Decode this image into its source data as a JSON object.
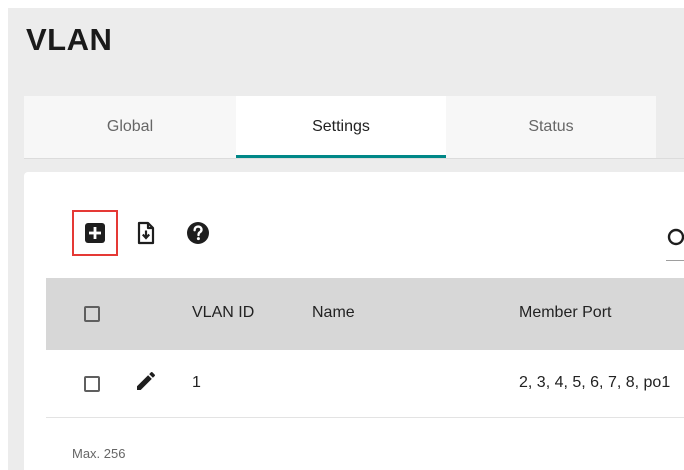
{
  "page": {
    "title": "VLAN"
  },
  "tabs": [
    {
      "label": "Global",
      "active": false
    },
    {
      "label": "Settings",
      "active": true
    },
    {
      "label": "Status",
      "active": false
    }
  ],
  "toolbar": {
    "add_icon": "add-box-icon",
    "export_icon": "file-download-icon",
    "help_icon": "help-circle-icon",
    "search_icon": "search-icon"
  },
  "table": {
    "columns": [
      "VLAN ID",
      "Name",
      "Member Port"
    ],
    "rows": [
      {
        "vlan_id": "1",
        "name": "",
        "member_port": "2, 3, 4, 5, 6, 7, 8, po1"
      }
    ],
    "footer": "Max. 256"
  },
  "colors": {
    "accent": "#008787",
    "highlight_border": "#e53935",
    "header_bg": "#d7d7d7",
    "page_bg": "#ececec"
  }
}
